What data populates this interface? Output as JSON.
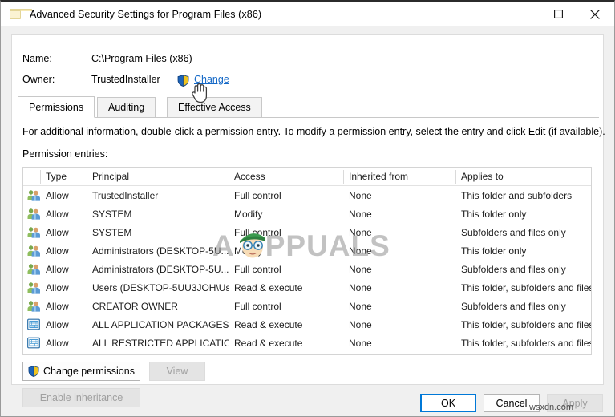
{
  "window": {
    "title": "Advanced Security Settings for Program Files (x86)",
    "icon": "folder-icon",
    "controls": {
      "minimize": "Minimize",
      "maximize": "Maximize",
      "close": "Close"
    }
  },
  "header": {
    "name_label": "Name:",
    "name_value": "C:\\Program Files (x86)",
    "owner_label": "Owner:",
    "owner_value": "TrustedInstaller",
    "change_link": "Change",
    "shield_icon": "uac-shield-icon"
  },
  "tabs": [
    {
      "label": "Permissions",
      "active": true
    },
    {
      "label": "Auditing",
      "active": false
    },
    {
      "label": "Effective Access",
      "active": false
    }
  ],
  "info_text": "For additional information, double-click a permission entry. To modify a permission entry, select the entry and click Edit (if available).",
  "entries_label": "Permission entries:",
  "table": {
    "columns": [
      "Type",
      "Principal",
      "Access",
      "Inherited from",
      "Applies to"
    ],
    "rows": [
      {
        "icon": "users-icon",
        "type": "Allow",
        "principal": "TrustedInstaller",
        "access": "Full control",
        "inherited": "None",
        "applies": "This folder and subfolders"
      },
      {
        "icon": "users-icon",
        "type": "Allow",
        "principal": "SYSTEM",
        "access": "Modify",
        "inherited": "None",
        "applies": "This folder only"
      },
      {
        "icon": "users-icon",
        "type": "Allow",
        "principal": "SYSTEM",
        "access": "Full control",
        "inherited": "None",
        "applies": "Subfolders and files only"
      },
      {
        "icon": "users-icon",
        "type": "Allow",
        "principal": "Administrators (DESKTOP-5U...",
        "access": "Modify",
        "inherited": "None",
        "applies": "This folder only"
      },
      {
        "icon": "users-icon",
        "type": "Allow",
        "principal": "Administrators (DESKTOP-5U...",
        "access": "Full control",
        "inherited": "None",
        "applies": "Subfolders and files only"
      },
      {
        "icon": "users-icon",
        "type": "Allow",
        "principal": "Users (DESKTOP-5UU3JOH\\Us...",
        "access": "Read & execute",
        "inherited": "None",
        "applies": "This folder, subfolders and files"
      },
      {
        "icon": "users-icon",
        "type": "Allow",
        "principal": "CREATOR OWNER",
        "access": "Full control",
        "inherited": "None",
        "applies": "Subfolders and files only"
      },
      {
        "icon": "app-package-icon",
        "type": "Allow",
        "principal": "ALL APPLICATION PACKAGES",
        "access": "Read & execute",
        "inherited": "None",
        "applies": "This folder, subfolders and files"
      },
      {
        "icon": "app-package-icon",
        "type": "Allow",
        "principal": "ALL RESTRICTED APPLICATIO...",
        "access": "Read & execute",
        "inherited": "None",
        "applies": "This folder, subfolders and files"
      }
    ]
  },
  "actions": {
    "change_permissions": "Change permissions",
    "view": "View",
    "enable_inheritance": "Enable inheritance"
  },
  "footer": {
    "ok": "OK",
    "cancel": "Cancel",
    "apply": "Apply"
  },
  "watermarks": {
    "brand": "PPUALS",
    "brand_initial": "A",
    "site": "wsxdn.com"
  },
  "colors": {
    "link": "#1569c7",
    "accent": "#0078d7",
    "panel_bg": "#ffffff",
    "window_bg": "#f0f0f0",
    "disabled_text": "#a0a0a0"
  }
}
